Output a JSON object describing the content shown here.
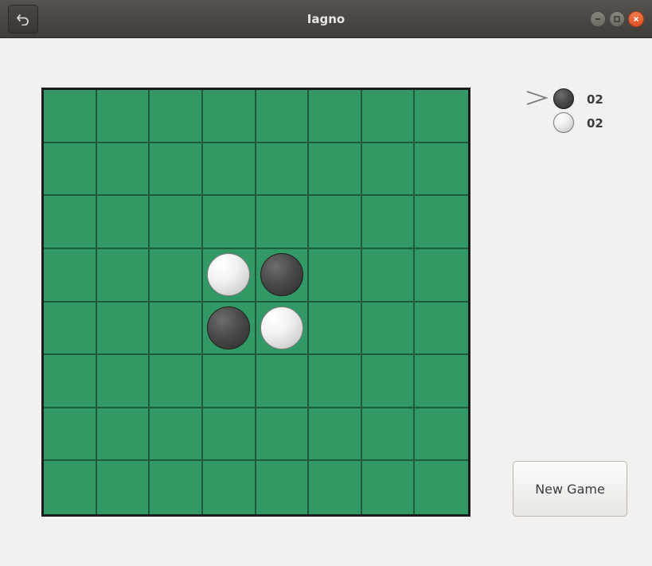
{
  "window": {
    "title": "Iagno"
  },
  "board": {
    "rows": 8,
    "cols": 8,
    "pieces": [
      {
        "row": 3,
        "col": 3,
        "color": "light"
      },
      {
        "row": 3,
        "col": 4,
        "color": "dark"
      },
      {
        "row": 4,
        "col": 3,
        "color": "dark"
      },
      {
        "row": 4,
        "col": 4,
        "color": "light"
      }
    ]
  },
  "scores": {
    "current_turn": "dark",
    "dark": "02",
    "light": "02"
  },
  "buttons": {
    "new_game": "New Game"
  },
  "icons": {
    "back": "undo-arrow-icon",
    "minimize": "minimize-icon",
    "maximize": "maximize-icon",
    "close": "close-icon",
    "turn": "turn-indicator-icon"
  },
  "colors": {
    "board": "#329966",
    "grid": "#1f5a3c",
    "titlebar": "#4a4642",
    "close": "#e35b2c"
  }
}
